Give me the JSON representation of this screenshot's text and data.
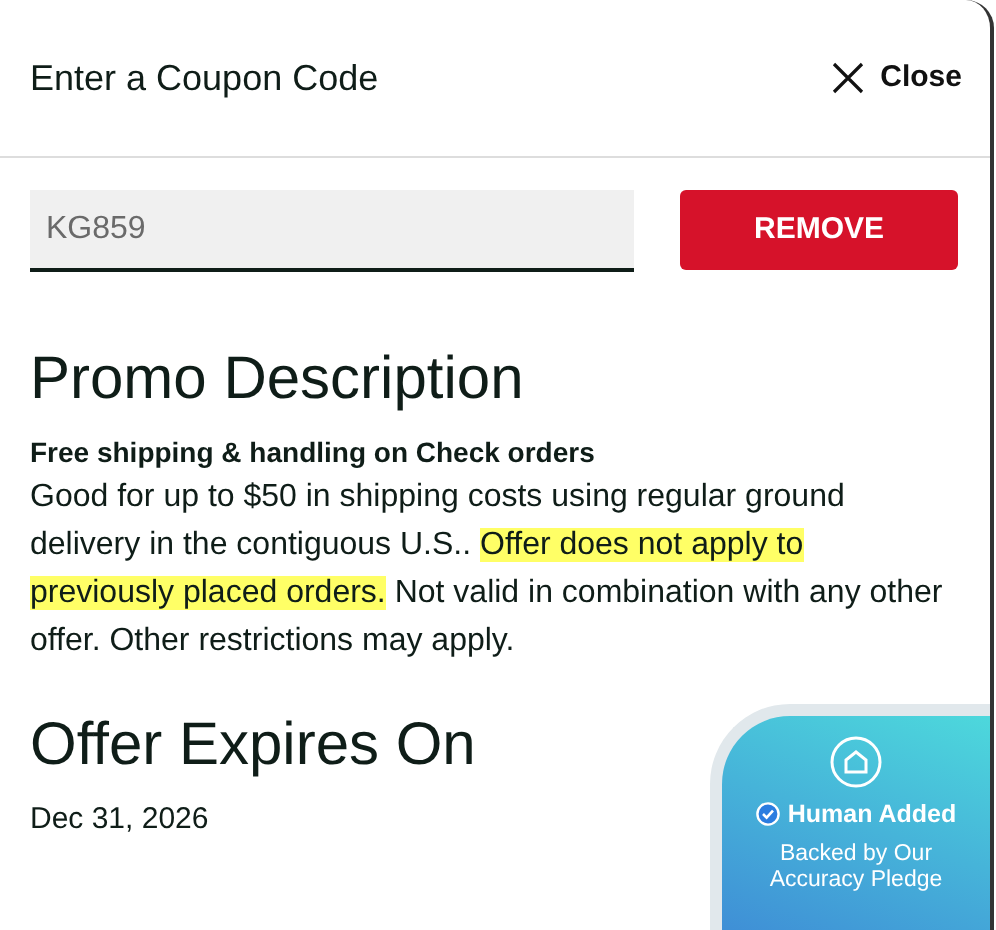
{
  "dialog": {
    "title": "Enter a Coupon Code",
    "close_label": "Close"
  },
  "coupon": {
    "value": "KG859",
    "button": "REMOVE"
  },
  "promo": {
    "heading": "Promo Description",
    "subtitle": "Free shipping & handling on Check orders",
    "description": [
      {
        "text": "Good for up to $50 in shipping costs using regular ground delivery in the contiguous U.S.. ",
        "highlighted": false
      },
      {
        "text": "Offer does not apply to previously placed orders.",
        "highlighted": true
      },
      {
        "text": " Not valid in combination with any other offer. Other restrictions may apply.",
        "highlighted": false
      }
    ]
  },
  "expiry": {
    "heading": "Offer Expires On",
    "date": "Dec 31, 2026"
  },
  "badge": {
    "title": "Human Added",
    "subtitle": "Backed by Our Accuracy Pledge"
  }
}
